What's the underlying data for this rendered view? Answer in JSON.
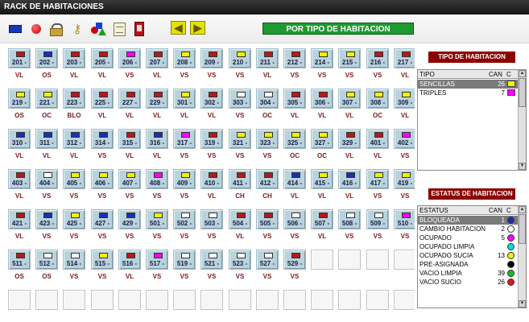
{
  "window": {
    "title": "RACK DE HABITACIONES"
  },
  "toolbar": {
    "icons": [
      "blue-rect-icon",
      "red-dot-icon",
      "lock-icon",
      "keys-icon",
      "shapes-icon",
      "document-icon",
      "exit-door-icon"
    ],
    "prev_arrow": "◀",
    "next_arrow": "▶",
    "mode_button": "POR TIPO DE HABITACION"
  },
  "colors": {
    "red": "#b81818",
    "yellow": "#f2f200",
    "magenta": "#ff00ff",
    "blue": "#1a2fb8",
    "white": "#ffffff",
    "green": "#1e9a30",
    "dark_red": "#8b0000"
  },
  "rooms": [
    [
      {
        "num": "201",
        "color": "red",
        "status": "VL"
      },
      {
        "num": "202",
        "color": "blue",
        "status": "OS"
      },
      {
        "num": "203",
        "color": "red",
        "status": "VL"
      },
      {
        "num": "205",
        "color": "red",
        "status": "VL"
      },
      {
        "num": "206",
        "color": "magenta",
        "status": "VS"
      },
      {
        "num": "207",
        "color": "red",
        "status": "VL"
      },
      {
        "num": "208",
        "color": "yellow",
        "status": "VS"
      },
      {
        "num": "209",
        "color": "red",
        "status": "VS"
      },
      {
        "num": "210",
        "color": "yellow",
        "status": "VS"
      },
      {
        "num": "211",
        "color": "red",
        "status": "VL"
      },
      {
        "num": "212",
        "color": "red",
        "status": "VS"
      },
      {
        "num": "214",
        "color": "yellow",
        "status": "VS"
      },
      {
        "num": "215",
        "color": "yellow",
        "status": "VS"
      },
      {
        "num": "216",
        "color": "red",
        "status": "VS"
      },
      {
        "num": "217",
        "color": "red",
        "status": "VL"
      }
    ],
    [
      {
        "num": "219",
        "color": "yellow",
        "status": "OS"
      },
      {
        "num": "221",
        "color": "yellow",
        "status": "OC"
      },
      {
        "num": "223",
        "color": "red",
        "status": "BLO"
      },
      {
        "num": "225",
        "color": "red",
        "status": "VL"
      },
      {
        "num": "227",
        "color": "red",
        "status": "VL"
      },
      {
        "num": "229",
        "color": "red",
        "status": "VL"
      },
      {
        "num": "301",
        "color": "yellow",
        "status": "VL"
      },
      {
        "num": "302",
        "color": "red",
        "status": "VL"
      },
      {
        "num": "303",
        "color": "white",
        "status": "VS"
      },
      {
        "num": "304",
        "color": "white",
        "status": "OC"
      },
      {
        "num": "305",
        "color": "red",
        "status": "VL"
      },
      {
        "num": "306",
        "color": "red",
        "status": "VL"
      },
      {
        "num": "307",
        "color": "yellow",
        "status": "VL"
      },
      {
        "num": "308",
        "color": "yellow",
        "status": "OC"
      },
      {
        "num": "309",
        "color": "yellow",
        "status": "VL"
      }
    ],
    [
      {
        "num": "310",
        "color": "blue",
        "status": "VL"
      },
      {
        "num": "311",
        "color": "blue",
        "status": "VL"
      },
      {
        "num": "312",
        "color": "blue",
        "status": "VL"
      },
      {
        "num": "314",
        "color": "blue",
        "status": "VS"
      },
      {
        "num": "315",
        "color": "red",
        "status": "VL"
      },
      {
        "num": "316",
        "color": "blue",
        "status": "VL"
      },
      {
        "num": "317",
        "color": "magenta",
        "status": "VS"
      },
      {
        "num": "319",
        "color": "red",
        "status": "VS"
      },
      {
        "num": "321",
        "color": "yellow",
        "status": "VS"
      },
      {
        "num": "323",
        "color": "yellow",
        "status": "VS"
      },
      {
        "num": "325",
        "color": "yellow",
        "status": "OC"
      },
      {
        "num": "327",
        "color": "yellow",
        "status": "OC"
      },
      {
        "num": "329",
        "color": "red",
        "status": "VL"
      },
      {
        "num": "401",
        "color": "red",
        "status": "VL"
      },
      {
        "num": "402",
        "color": "magenta",
        "status": "VS"
      }
    ],
    [
      {
        "num": "403",
        "color": "red",
        "status": "VL"
      },
      {
        "num": "404",
        "color": "white",
        "status": "VS"
      },
      {
        "num": "405",
        "color": "yellow",
        "status": "VS"
      },
      {
        "num": "406",
        "color": "yellow",
        "status": "VS"
      },
      {
        "num": "407",
        "color": "yellow",
        "status": "VS"
      },
      {
        "num": "408",
        "color": "magenta",
        "status": "VS"
      },
      {
        "num": "409",
        "color": "yellow",
        "status": "VS"
      },
      {
        "num": "410",
        "color": "red",
        "status": "VL"
      },
      {
        "num": "411",
        "color": "red",
        "status": "CH"
      },
      {
        "num": "412",
        "color": "red",
        "status": "CH"
      },
      {
        "num": "414",
        "color": "blue",
        "status": "VL"
      },
      {
        "num": "415",
        "color": "yellow",
        "status": "VL"
      },
      {
        "num": "416",
        "color": "blue",
        "status": "VL"
      },
      {
        "num": "417",
        "color": "yellow",
        "status": "VS"
      },
      {
        "num": "419",
        "color": "yellow",
        "status": "VS"
      }
    ],
    [
      {
        "num": "421",
        "color": "red",
        "status": "VL"
      },
      {
        "num": "423",
        "color": "blue",
        "status": "VS"
      },
      {
        "num": "425",
        "color": "yellow",
        "status": "VS"
      },
      {
        "num": "427",
        "color": "blue",
        "status": "VS"
      },
      {
        "num": "429",
        "color": "blue",
        "status": "VS"
      },
      {
        "num": "501",
        "color": "yellow",
        "status": "VS"
      },
      {
        "num": "502",
        "color": "white",
        "status": "VS"
      },
      {
        "num": "503",
        "color": "white",
        "status": "VS"
      },
      {
        "num": "504",
        "color": "red",
        "status": "VL"
      },
      {
        "num": "505",
        "color": "red",
        "status": "VS"
      },
      {
        "num": "506",
        "color": "white",
        "status": "VS"
      },
      {
        "num": "507",
        "color": "red",
        "status": "VL"
      },
      {
        "num": "508",
        "color": "white",
        "status": "VS"
      },
      {
        "num": "509",
        "color": "white",
        "status": "VS"
      },
      {
        "num": "510",
        "color": "magenta",
        "status": "VS"
      }
    ],
    [
      {
        "num": "511",
        "color": "red",
        "status": "OS"
      },
      {
        "num": "512",
        "color": "white",
        "status": "OS"
      },
      {
        "num": "514",
        "color": "white",
        "status": "VS"
      },
      {
        "num": "515",
        "color": "yellow",
        "status": "VS"
      },
      {
        "num": "516",
        "color": "red",
        "status": "VL"
      },
      {
        "num": "517",
        "color": "magenta",
        "status": "VS"
      },
      {
        "num": "519",
        "color": "white",
        "status": "VS"
      },
      {
        "num": "521",
        "color": "white",
        "status": "VS"
      },
      {
        "num": "523",
        "color": "white",
        "status": "VS"
      },
      {
        "num": "527",
        "color": "white",
        "status": "VS"
      },
      {
        "num": "529",
        "color": "red",
        "status": "VS"
      }
    ]
  ],
  "tipo_panel": {
    "title": "TIPO DE HABITACION",
    "headers": [
      "TIPO",
      "CAN",
      "C"
    ],
    "rows": [
      {
        "name": "SENCILLAS",
        "count": "26",
        "color": "#f2f200",
        "selected": true
      },
      {
        "name": "TRIPLES",
        "count": "7",
        "color": "#ff00ff",
        "selected": false
      }
    ]
  },
  "estatus_panel": {
    "title": "ESTATUS DE HABITACION",
    "headers": [
      "ESTATUS",
      "CAN",
      "C"
    ],
    "rows": [
      {
        "name": "BLOQUEADA",
        "count": "1",
        "color": "#1a2fb8",
        "selected": true
      },
      {
        "name": "CAMBIO HABITACION",
        "count": "2",
        "color": "#ffffff",
        "selected": false
      },
      {
        "name": "OCUPADO",
        "count": "5",
        "color": "#ff00ff",
        "selected": false
      },
      {
        "name": "OCUPADO LIMPIA",
        "count": "",
        "color": "#00e0e0",
        "selected": false
      },
      {
        "name": "OCUPADO SUCIA",
        "count": "13",
        "color": "#f2f200",
        "selected": false
      },
      {
        "name": "PRE-ASIGNADA",
        "count": "",
        "color": "#000000",
        "selected": false
      },
      {
        "name": "VACIO LIMPIA",
        "count": "39",
        "color": "#18c018",
        "selected": false
      },
      {
        "name": "VACIO SUCIO",
        "count": "26",
        "color": "#e01818",
        "selected": false
      }
    ]
  }
}
